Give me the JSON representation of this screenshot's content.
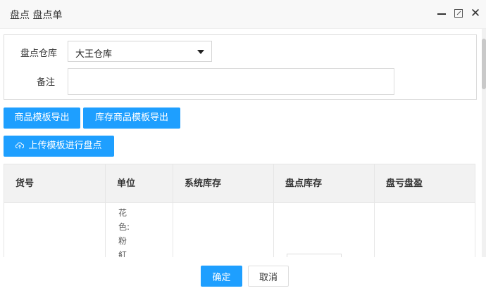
{
  "window": {
    "title": "盘点 盘点单",
    "controls": {
      "minimize": "minimize-icon",
      "maximize": "maximize-icon",
      "close": "close-icon",
      "close_glyph": "✕"
    }
  },
  "form": {
    "warehouse_label": "盘点仓库",
    "warehouse_value": "大王仓库",
    "note_label": "备注",
    "note_value": ""
  },
  "toolbar": {
    "export_template_label": "商品模板导出",
    "export_stock_template_label": "库存商品模板导出",
    "upload_label": "上传模板进行盘点",
    "upload_icon": "cloud-upload-icon"
  },
  "table": {
    "columns": [
      "货号",
      "单位",
      "系统库存",
      "盘点库存",
      "盘亏盘盈"
    ],
    "rows": [
      {
        "sku": "",
        "unit_spec": "花色:粉紅",
        "system_stock": "",
        "counted_stock": "",
        "difference": ""
      }
    ]
  },
  "footer": {
    "confirm_label": "确定",
    "cancel_label": "取消"
  },
  "colors": {
    "primary": "#1e9fff",
    "header_bg": "#f2f2f2",
    "titlebar_bg": "#f8f8f8"
  }
}
